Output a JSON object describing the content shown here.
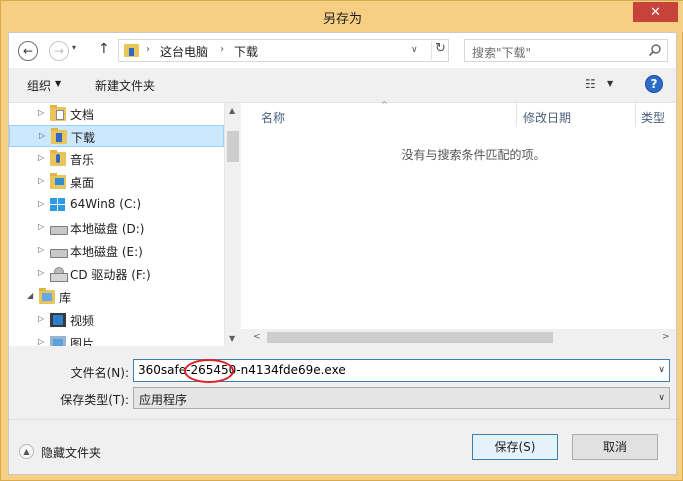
{
  "window": {
    "title": "另存为",
    "close_glyph": "✕"
  },
  "address": {
    "back_glyph": "←",
    "forward_glyph": "→",
    "recent_glyph": "▾",
    "up_glyph": "↑",
    "sep": "›",
    "crumbs": [
      "这台电脑",
      "下载"
    ],
    "dropdown_glyph": "∨",
    "refresh_glyph": "↻"
  },
  "search": {
    "placeholder": "搜索\"下载\""
  },
  "toolbar": {
    "organize": "组织",
    "arrow": "▼",
    "new_folder": "新建文件夹",
    "view_glyph": "☷",
    "help_glyph": "?"
  },
  "nav": {
    "expand_glyph": "▷",
    "expanded_glyph": "◢",
    "items": [
      {
        "label": "文档",
        "icon": "documents-folder-icon"
      },
      {
        "label": "下载",
        "icon": "downloads-folder-icon",
        "selected": true
      },
      {
        "label": "音乐",
        "icon": "music-folder-icon"
      },
      {
        "label": "桌面",
        "icon": "desktop-folder-icon"
      },
      {
        "label": "64Win8 (C:)",
        "icon": "windows-drive-icon"
      },
      {
        "label": "本地磁盘 (D:)",
        "icon": "drive-icon"
      },
      {
        "label": "本地磁盘 (E:)",
        "icon": "drive-icon"
      },
      {
        "label": "CD 驱动器 (F:)",
        "icon": "cd-drive-icon"
      },
      {
        "label": "库",
        "icon": "library-icon",
        "expanded": true
      },
      {
        "label": "视频",
        "icon": "videos-library-icon"
      },
      {
        "label": "图片",
        "icon": "pictures-library-icon"
      }
    ],
    "scroll_up": "▲",
    "scroll_down": "▼"
  },
  "file_list": {
    "columns": [
      "名称",
      "修改日期",
      "类型"
    ],
    "sort_glyph": "^",
    "empty_message": "没有与搜索条件匹配的项。",
    "scroll_left": "<",
    "scroll_right": ">"
  },
  "save_form": {
    "filename_label": "文件名(N):",
    "filename_value": "360safe-265450-n4134fde69e.exe",
    "filetype_label": "保存类型(T):",
    "filetype_value": "应用程序",
    "dropdown_glyph": "∨"
  },
  "footer": {
    "hide_folders_glyph": "▲",
    "hide_folders": "隐藏文件夹",
    "save": "保存(S)",
    "cancel": "取消"
  }
}
